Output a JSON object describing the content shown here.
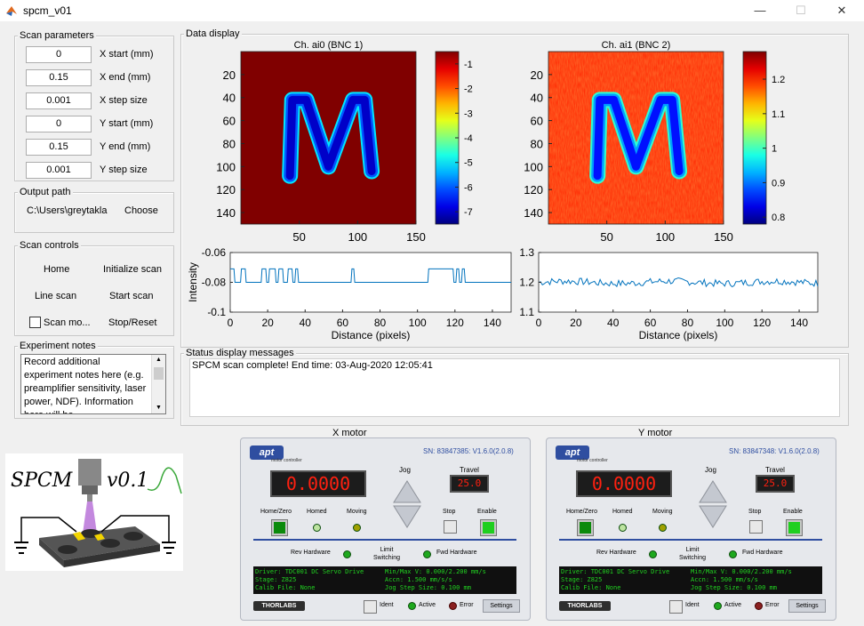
{
  "window": {
    "title": "spcm_v01",
    "minimize": "—",
    "maximize": "☐",
    "close": "✕"
  },
  "scan_params": {
    "title": "Scan parameters",
    "fields": [
      {
        "value": "0",
        "label": "X start (mm)"
      },
      {
        "value": "0.15",
        "label": "X end (mm)"
      },
      {
        "value": "0.001",
        "label": "X step size"
      },
      {
        "value": "0",
        "label": "Y start (mm)"
      },
      {
        "value": "0.15",
        "label": "Y end (mm)"
      },
      {
        "value": "0.001",
        "label": "Y step size"
      }
    ]
  },
  "output_path": {
    "title": "Output path",
    "path": "C:\\Users\\greytakla",
    "choose": "Choose"
  },
  "scan_controls": {
    "title": "Scan controls",
    "home": "Home",
    "initialize": "Initialize scan",
    "line_scan": "Line scan",
    "start_scan": "Start scan",
    "scan_mode": "Scan mo...",
    "stop_reset": "Stop/Reset",
    "scan_mode_checked": false
  },
  "experiment_notes": {
    "title": "Experiment notes",
    "text": "Record additional experiment notes here (e.g. preamplifier sensitivity, laser power, NDF). Information here will be"
  },
  "logo": {
    "text": "SPCM",
    "version": "v0.1"
  },
  "data_display": {
    "title": "Data display"
  },
  "chart_data": [
    {
      "type": "heatmap",
      "title": "Ch. ai0 (BNC 1)",
      "xticks": [
        "50",
        "100",
        "150"
      ],
      "yticks": [
        "20",
        "40",
        "60",
        "80",
        "100",
        "120",
        "140"
      ],
      "colorbar_ticks": [
        "-1",
        "-2",
        "-3",
        "-4",
        "-5",
        "-6",
        "-7"
      ],
      "colorbar_range": [
        -7.5,
        -0.5
      ],
      "background_value": -0.06,
      "feature": "M",
      "feature_value": -7
    },
    {
      "type": "heatmap",
      "title": "Ch. ai1 (BNC 2)",
      "xticks": [
        "50",
        "100",
        "150"
      ],
      "yticks": [
        "20",
        "40",
        "60",
        "80",
        "100",
        "120",
        "140"
      ],
      "colorbar_ticks": [
        "1.2",
        "1.1",
        "1",
        "0.9",
        "0.8"
      ],
      "colorbar_range": [
        0.78,
        1.28
      ],
      "background_value": 1.2,
      "feature": "M",
      "feature_value": 0.85
    },
    {
      "type": "line",
      "xlabel": "Distance (pixels)",
      "ylabel": "Intensity",
      "xticks": [
        "0",
        "20",
        "40",
        "60",
        "80",
        "100",
        "120",
        "140"
      ],
      "yticks": [
        "-0.06",
        "-0.08",
        "-0.1"
      ],
      "xlim": [
        0,
        150
      ],
      "ylim": [
        -0.1,
        -0.06
      ],
      "baseline": -0.08,
      "pulse_level": -0.071,
      "pulses": [
        [
          0,
          2
        ],
        [
          6,
          8
        ],
        [
          17,
          19
        ],
        [
          21,
          24
        ],
        [
          26,
          28
        ],
        [
          31,
          33
        ],
        [
          35,
          36
        ],
        [
          65,
          66
        ],
        [
          106,
          118
        ],
        [
          118,
          119
        ],
        [
          121,
          122
        ],
        [
          124,
          125
        ]
      ]
    },
    {
      "type": "line",
      "xlabel": "Distance (pixels)",
      "ylabel": "",
      "xticks": [
        "0",
        "20",
        "40",
        "60",
        "80",
        "100",
        "120",
        "140"
      ],
      "yticks": [
        "1.3",
        "1.2",
        "1.1"
      ],
      "xlim": [
        0,
        150
      ],
      "ylim": [
        1.1,
        1.3
      ],
      "mean": 1.2,
      "noise_amplitude": 0.012
    }
  ],
  "status": {
    "title": "Status display messages",
    "message": "SPCM scan complete! End time: 03-Aug-2020 12:05:41"
  },
  "motors": [
    {
      "title": "X motor",
      "sn": "SN: 83847385: V1.6.0(2.0.8)",
      "position": "0.0000",
      "travel": "25.0",
      "jog": "Jog",
      "travel_label": "Travel",
      "home_zero": "Home/Zero",
      "homed": "Homed",
      "moving": "Moving",
      "stop": "Stop",
      "enable": "Enable",
      "rev_hw": "Rev Hardware",
      "limit_switching": "Limit Switching",
      "fwd_hw": "Fwd Hardware",
      "info_left": [
        "Driver: TDC001 DC Servo Drive",
        "Stage: Z825",
        "Calib File: None"
      ],
      "info_right": [
        "Min/Max V: 0.000/2.200 mm/s",
        "Accn: 1.500 mm/s/s",
        "Jog Step Size: 0.100 mm"
      ],
      "brand": "THORLABS",
      "ident": "Ident",
      "active": "Active",
      "error": "Error",
      "settings": "Settings",
      "apt_logo": "apt",
      "apt_sub": "motor controller"
    },
    {
      "title": "Y motor",
      "sn": "SN: 83847348: V1.6.0(2.0.8)",
      "position": "0.0000",
      "travel": "25.0",
      "jog": "Jog",
      "travel_label": "Travel",
      "home_zero": "Home/Zero",
      "homed": "Homed",
      "moving": "Moving",
      "stop": "Stop",
      "enable": "Enable",
      "rev_hw": "Rev Hardware",
      "limit_switching": "Limit Switching",
      "fwd_hw": "Fwd Hardware",
      "info_left": [
        "Driver: TDC001 DC Servo Drive",
        "Stage: Z825",
        "Calib File: None"
      ],
      "info_right": [
        "Min/Max V: 0.000/2.200 mm/s",
        "Accn: 1.500 mm/s/s",
        "Jog Step Size: 0.100 mm"
      ],
      "brand": "THORLABS",
      "ident": "Ident",
      "active": "Active",
      "error": "Error",
      "settings": "Settings",
      "apt_logo": "apt",
      "apt_sub": "motor controller"
    }
  ]
}
